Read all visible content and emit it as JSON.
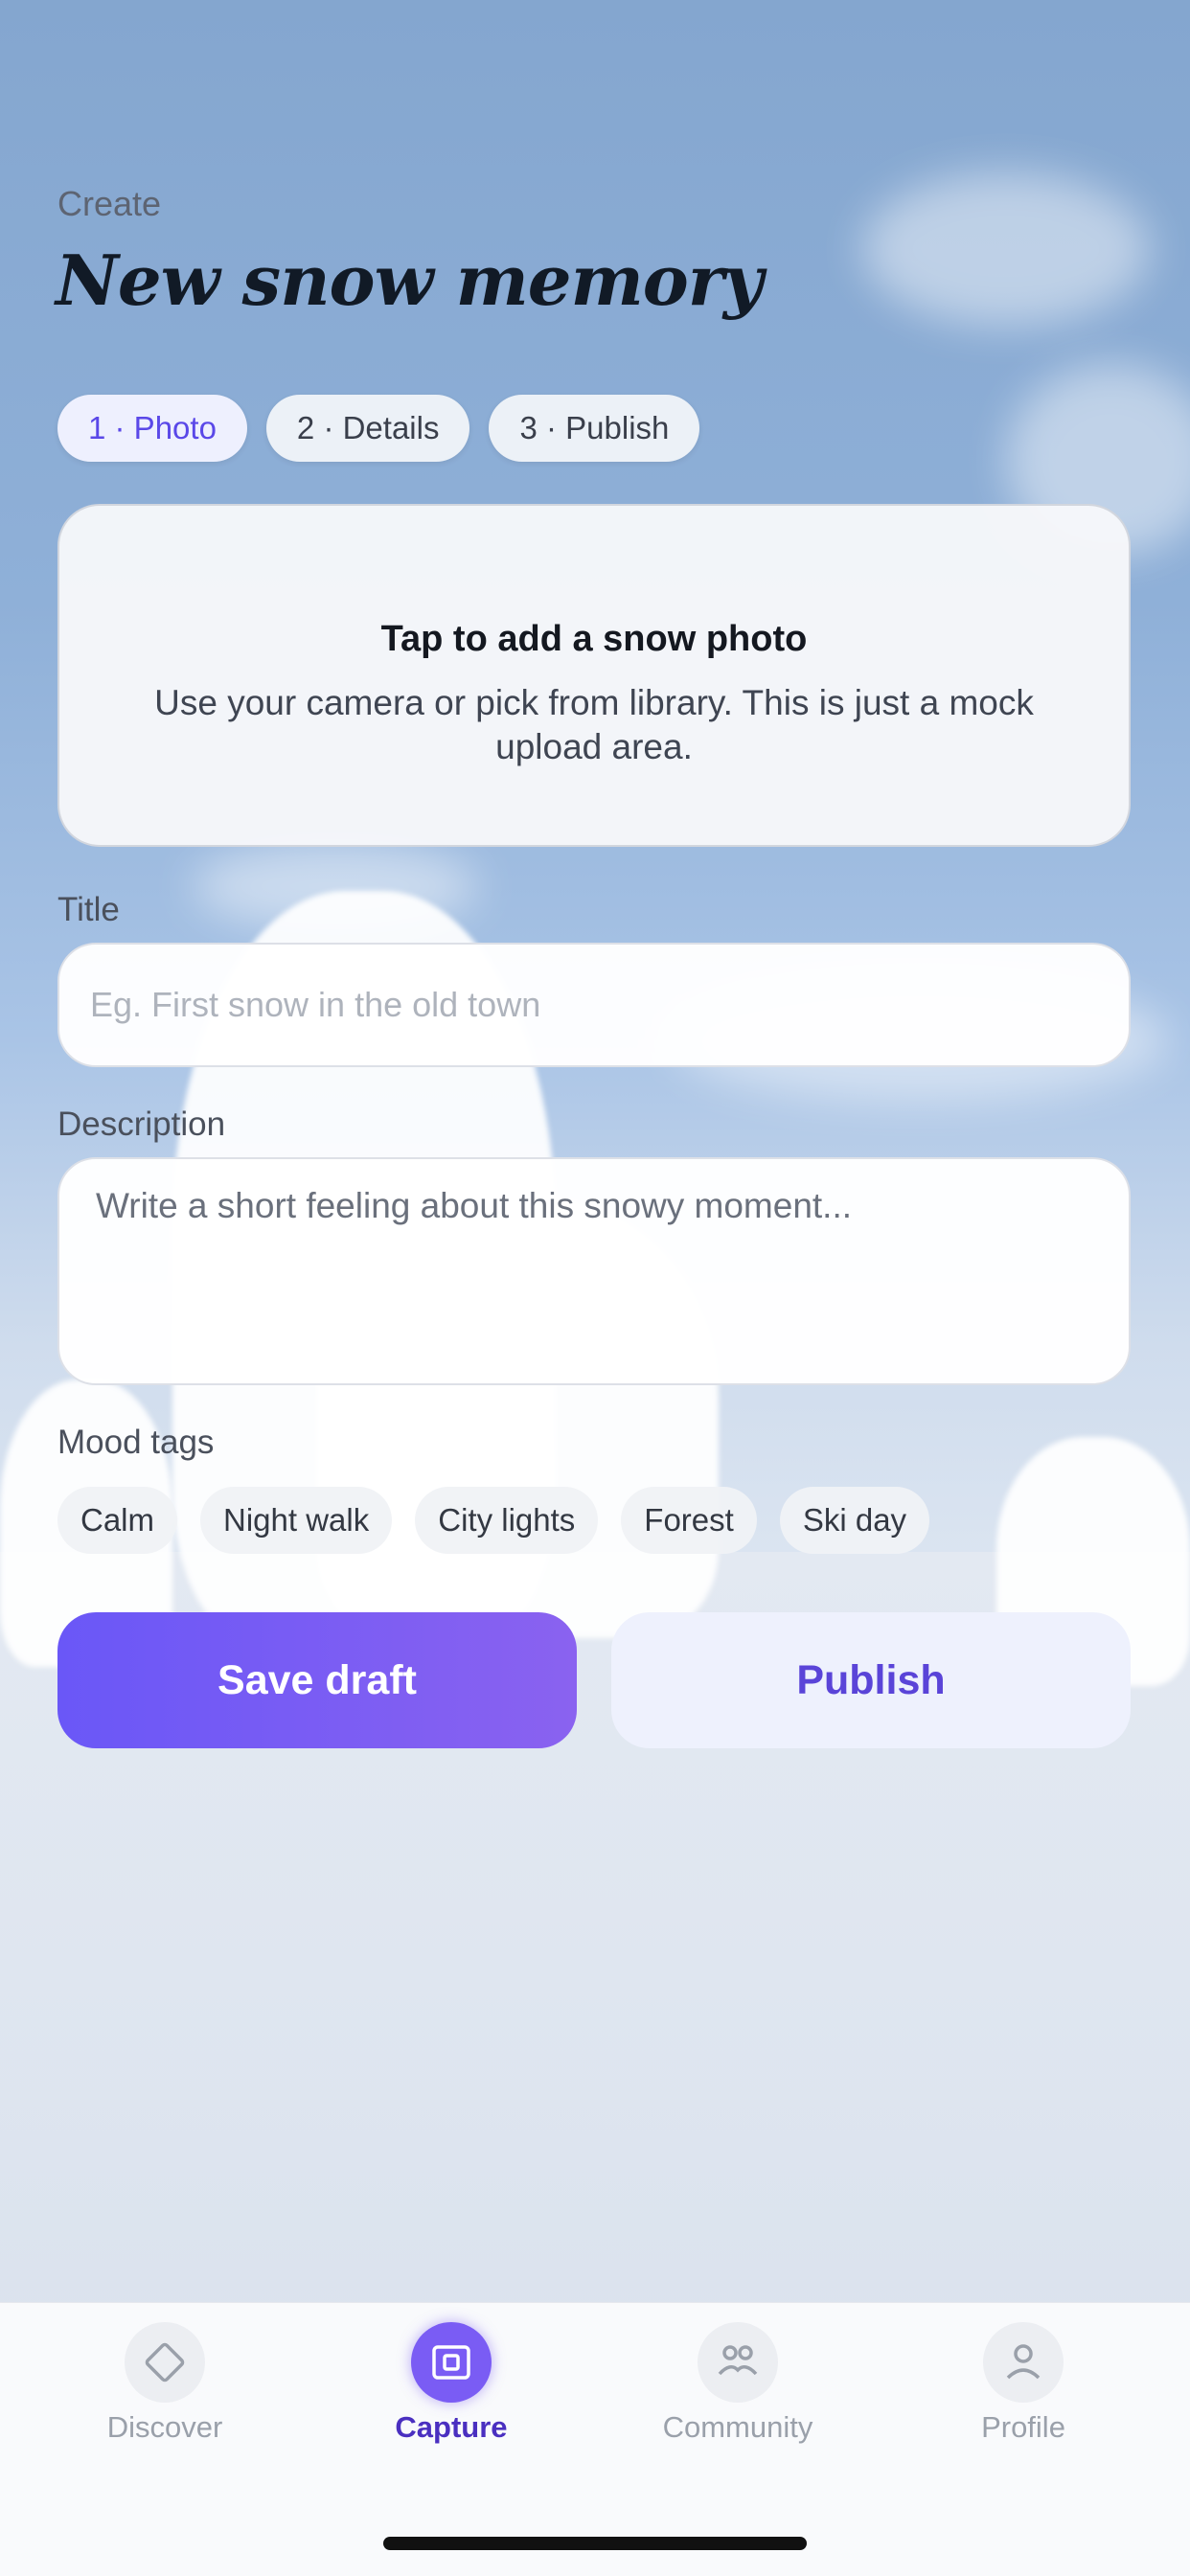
{
  "header": {
    "eyebrow": "Create",
    "title": "New snow memory"
  },
  "steps": [
    {
      "label": "1 · Photo",
      "active": true
    },
    {
      "label": "2 · Details",
      "active": false
    },
    {
      "label": "3 · Publish",
      "active": false
    }
  ],
  "upload": {
    "title": "Tap to add a snow photo",
    "description": "Use your camera or pick from library. This is just a mock upload area."
  },
  "form": {
    "title_label": "Title",
    "title_placeholder": "Eg. First snow in the old town",
    "description_label": "Description",
    "description_placeholder": "Write a short feeling about this snowy moment...",
    "mood_label": "Mood tags",
    "mood_tags": [
      "Calm",
      "Night walk",
      "City lights",
      "Forest",
      "Ski day"
    ]
  },
  "actions": {
    "save_draft": "Save draft",
    "publish": "Publish"
  },
  "tabbar": {
    "items": [
      {
        "label": "Discover",
        "icon": "diamond-icon",
        "active": false
      },
      {
        "label": "Capture",
        "icon": "camera-frame-icon",
        "active": true
      },
      {
        "label": "Community",
        "icon": "community-icon",
        "active": false
      },
      {
        "label": "Profile",
        "icon": "person-icon",
        "active": false
      }
    ]
  },
  "colors": {
    "accent": "#6a57f7",
    "accent_text": "#5a44d8",
    "active_tab": "#4a2fc0"
  }
}
